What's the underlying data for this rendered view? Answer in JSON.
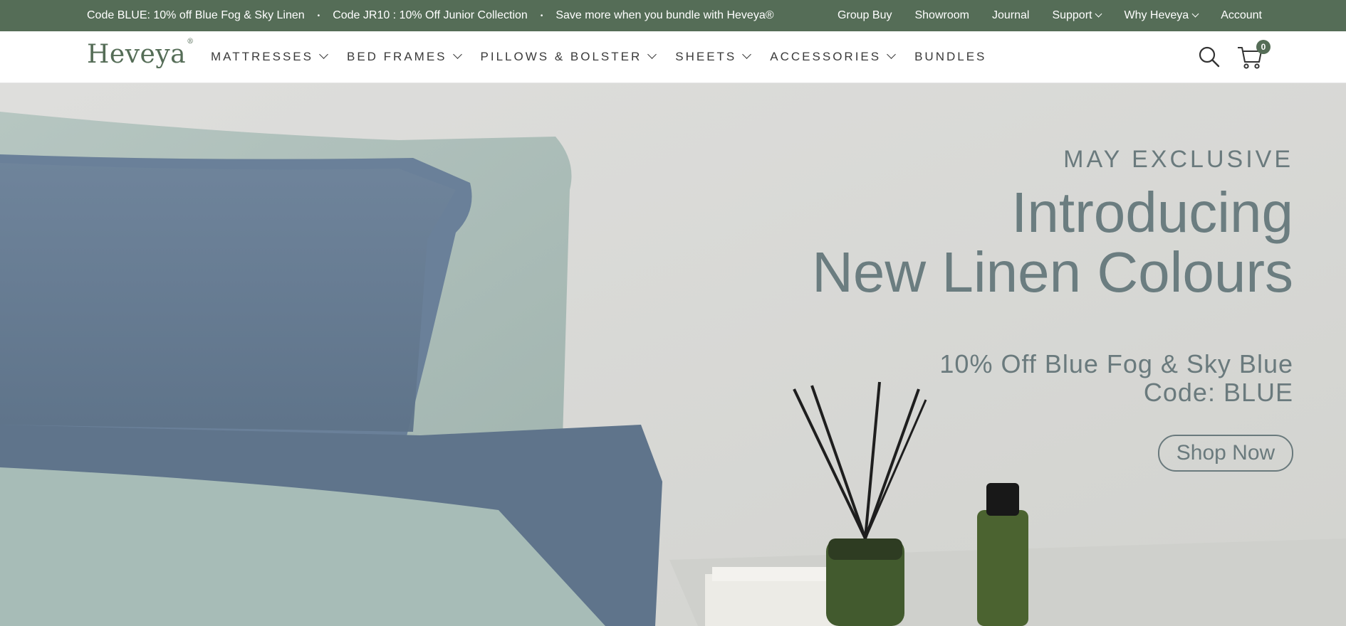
{
  "topbar": {
    "promos": [
      "Code BLUE: 10% off Blue Fog & Sky Linen",
      "Code JR10 : 10% Off Junior Collection",
      "Save more when you bundle with Heveya®"
    ],
    "separator": "•",
    "links": [
      {
        "label": "Group Buy"
      },
      {
        "label": "Showroom"
      },
      {
        "label": "Journal"
      },
      {
        "label": "Support"
      },
      {
        "label": "Why Heveya"
      },
      {
        "label": "Account"
      }
    ]
  },
  "nav": {
    "logo": "Heveya",
    "logo_mark": "®",
    "menu": [
      {
        "label": "MATTRESSES"
      },
      {
        "label": "BED FRAMES"
      },
      {
        "label": "PILLOWS & BOLSTER"
      },
      {
        "label": "SHEETS"
      },
      {
        "label": "ACCESSORIES"
      },
      {
        "label": "BUNDLES"
      }
    ],
    "search_icon": "search-icon",
    "cart_icon": "cart-icon",
    "cart_count": "0"
  },
  "hero": {
    "eyebrow": "MAY EXCLUSIVE",
    "headline_line1": "Introducing",
    "headline_line2": "New Linen Colours",
    "offer_line1": "10% Off Blue Fog & Sky Blue",
    "offer_line2": "Code: BLUE",
    "cta": "Shop Now"
  },
  "colors": {
    "brand_green": "#556d57",
    "hero_text": "#6a7a7d",
    "pillow_blue": "#657d95",
    "pillow_sky": "#a9bdb8"
  }
}
